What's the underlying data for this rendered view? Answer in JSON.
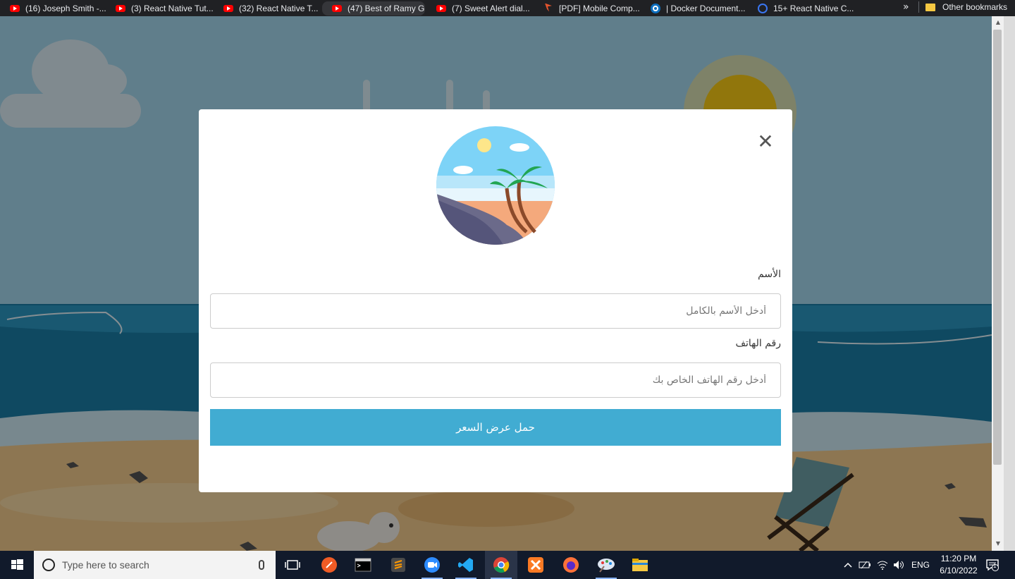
{
  "bookmarks": {
    "items": [
      {
        "label": "(16) Joseph Smith -...",
        "icon": "youtube-icon"
      },
      {
        "label": "(3) React Native Tut...",
        "icon": "youtube-icon"
      },
      {
        "label": "(32) React Native T...",
        "icon": "youtube-icon"
      },
      {
        "label": "(47) Best of Ramy G...",
        "icon": "youtube-icon"
      },
      {
        "label": "(7) Sweet Alert dial...",
        "icon": "youtube-icon"
      },
      {
        "label": "[PDF] Mobile Comp...",
        "icon": "pdf-icon"
      },
      {
        "label": "| Docker Document...",
        "icon": "docker-icon"
      },
      {
        "label": "15+ React Native C...",
        "icon": "gear-icon"
      }
    ],
    "overflow": "»",
    "other": "Other bookmarks"
  },
  "modal": {
    "close": "✕",
    "name_label": "الأسم",
    "name_placeholder": "أدخل الأسم بالكامل",
    "phone_label": "رقم الهاتف",
    "phone_placeholder": "أدخل رقم الهاتف الخاص بك",
    "submit": "حمل عرض السعر"
  },
  "taskbar": {
    "search_placeholder": "Type here to search",
    "language": "ENG",
    "time": "11:20 PM",
    "date": "6/10/2022",
    "notification_count": "1"
  },
  "colors": {
    "accent_button": "#41acd2",
    "taskbar": "#111a2b"
  }
}
